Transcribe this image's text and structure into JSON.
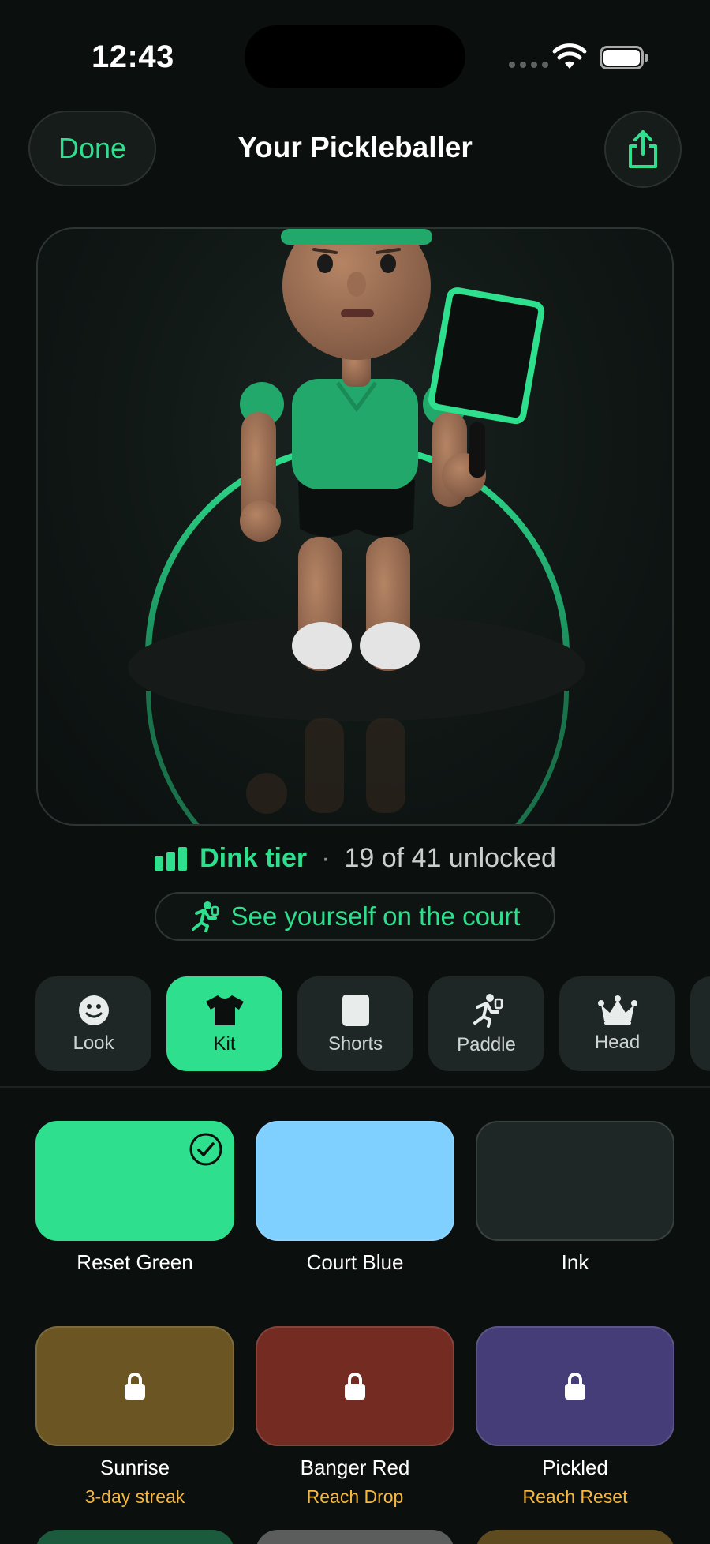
{
  "status_bar": {
    "time": "12:43"
  },
  "nav": {
    "done_label": "Done",
    "title": "Your Pickleballer"
  },
  "tier": {
    "name": "Dink tier",
    "separator": "·",
    "progress_text": "19 of 41 unlocked"
  },
  "court_button": {
    "label": "See yourself on the court"
  },
  "tabs": [
    {
      "label": "Look",
      "icon": "smiley-icon",
      "active": false
    },
    {
      "label": "Kit",
      "icon": "tshirt-icon",
      "active": true
    },
    {
      "label": "Shorts",
      "icon": "shorts-icon",
      "active": false
    },
    {
      "label": "Paddle",
      "icon": "player-icon",
      "active": false
    },
    {
      "label": "Head",
      "icon": "crown-icon",
      "active": false
    }
  ],
  "swatches": [
    {
      "name": "Reset Green",
      "color": "#2ee08e",
      "selected": true,
      "locked": false,
      "requirement": ""
    },
    {
      "name": "Court Blue",
      "color": "#7fcfff",
      "selected": false,
      "locked": false,
      "requirement": ""
    },
    {
      "name": "Ink",
      "color": "#1e2725",
      "selected": false,
      "locked": false,
      "requirement": ""
    },
    {
      "name": "Sunrise",
      "color": "#6b5623",
      "selected": false,
      "locked": true,
      "requirement": "3-day streak"
    },
    {
      "name": "Banger Red",
      "color": "#742b21",
      "selected": false,
      "locked": true,
      "requirement": "Reach Drop"
    },
    {
      "name": "Pickled",
      "color": "#453d78",
      "selected": false,
      "locked": true,
      "requirement": "Reach Reset"
    }
  ],
  "colors": {
    "accent": "#2ee08e",
    "locked_text": "#f5b83d",
    "background": "#0b0f0e"
  }
}
